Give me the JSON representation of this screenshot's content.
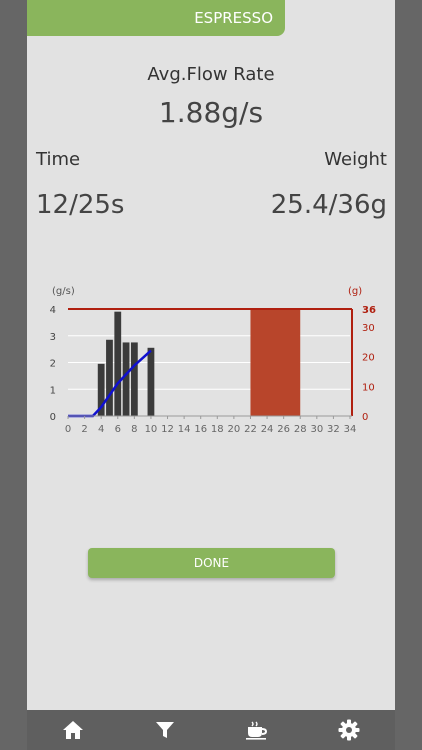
{
  "header": {
    "mode": "ESPRESSO"
  },
  "stats": {
    "flow_label": "Avg.Flow Rate",
    "flow_value": "1.88g/s",
    "time_label": "Time",
    "time_value": "12/25s",
    "weight_label": "Weight",
    "weight_value": "25.4/36g"
  },
  "chart_data": {
    "type": "bar",
    "left_unit": "(g/s)",
    "right_unit": "(g)",
    "x_ticks": [
      0,
      2,
      4,
      6,
      8,
      10,
      12,
      14,
      16,
      18,
      20,
      22,
      24,
      26,
      28,
      30,
      32,
      34
    ],
    "y_left_ticks": [
      0,
      1,
      2,
      3,
      4
    ],
    "y_right_ticks": [
      0,
      10,
      20,
      30,
      36
    ],
    "xlim": [
      0,
      34
    ],
    "ylim_left": [
      0,
      4
    ],
    "ylim_right": [
      0,
      36
    ],
    "flow_bars": {
      "x": [
        4,
        5,
        6,
        7,
        8,
        10
      ],
      "values": [
        1.95,
        2.85,
        3.9,
        2.75,
        2.75,
        2.55
      ]
    },
    "weight_line": {
      "x": [
        0,
        3,
        4,
        5,
        6,
        7,
        8,
        9,
        10
      ],
      "values": [
        0,
        0,
        3,
        7,
        11,
        14,
        17,
        19.5,
        22
      ]
    },
    "target_weight": 36,
    "target_time_window": [
      22,
      28
    ],
    "colors": {
      "bars": "#3b3b3b",
      "weight_line": "#1010d0",
      "target": "#b02010",
      "target_band": "#b8452b",
      "accent": "#8ab55c"
    }
  },
  "actions": {
    "done_label": "DONE"
  },
  "nav": {
    "items": [
      {
        "icon": "home-icon"
      },
      {
        "icon": "filter-icon"
      },
      {
        "icon": "coffee-cup-icon"
      },
      {
        "icon": "gear-icon"
      }
    ]
  }
}
